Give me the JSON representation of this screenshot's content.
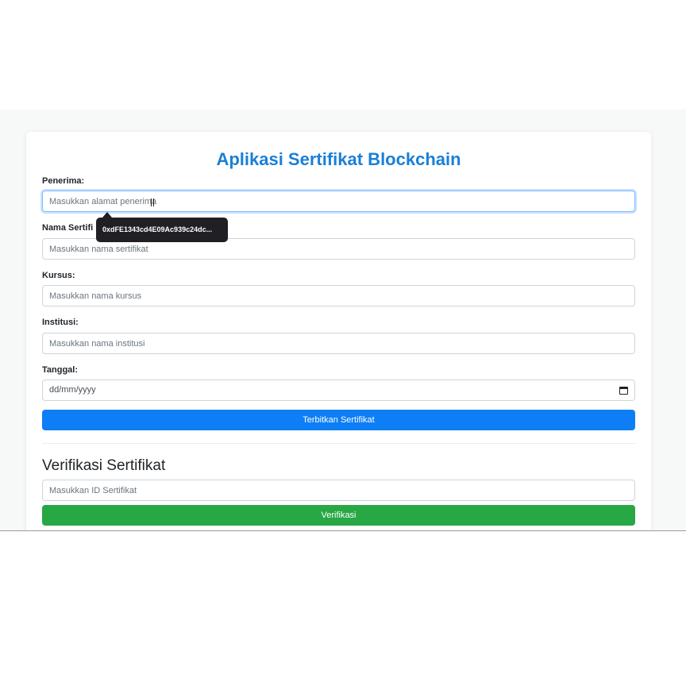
{
  "app": {
    "title": "Aplikasi Sertifikat Blockchain"
  },
  "form": {
    "recipient_label": "Penerima:",
    "recipient_placeholder": "Masukkan alamat penerima",
    "cert_name_label": "Nama Sertifi",
    "cert_name_placeholder": "Masukkan nama sertifikat",
    "course_label": "Kursus:",
    "course_placeholder": "Masukkan nama kursus",
    "institution_label": "Institusi:",
    "institution_placeholder": "Masukkan nama institusi",
    "date_label": "Tanggal:",
    "date_placeholder": "dd/mm/yyyy",
    "issue_button": "Terbitkan Sertifikat"
  },
  "tooltip": {
    "text": "0xdFE1343cd4E09Ac939c24dc..."
  },
  "verify": {
    "title": "Verifikasi Sertifikat",
    "id_placeholder": "Masukkan ID Sertifikat",
    "verify_button": "Verifikasi"
  },
  "colors": {
    "title_accent": "#1a7fd6",
    "primary_button": "#0d7ef5",
    "success_button": "#28a745",
    "tooltip_bg": "#1f1f24"
  },
  "icons": {
    "date_picker": "calendar-icon"
  }
}
